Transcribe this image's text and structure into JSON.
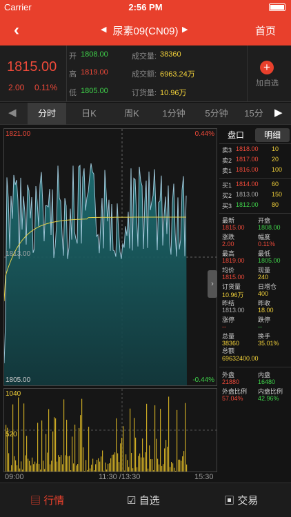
{
  "status": {
    "carrier": "Carrier",
    "time": "2:56 PM"
  },
  "nav": {
    "title": "尿素09(CN09)",
    "home": "首页"
  },
  "quote": {
    "price": "1815.00",
    "change": "2.00",
    "pct": "0.11%",
    "open_label": "开",
    "open": "1808.00",
    "high_label": "高",
    "high": "1819.00",
    "low_label": "低",
    "low": "1805.00",
    "vol_label": "成交量:",
    "vol": "38360",
    "amt_label": "成交额:",
    "amt": "6963.24万",
    "oi_label": "订货量:",
    "oi": "10.96万",
    "add_label": "加自选"
  },
  "tabs": [
    "分时",
    "日K",
    "周K",
    "1分钟",
    "5分钟",
    "15分"
  ],
  "chart": {
    "top_price": "1821.00",
    "bottom_price": "1805.00",
    "mid_price": "1813.00",
    "top_pct": "0.44%",
    "bottom_pct": "-0.44%",
    "vol_top": "1040",
    "vol_mid": "520",
    "x_start": "09:00",
    "x_mid": "11:30 /13:30",
    "x_end": "15:30"
  },
  "side": {
    "tab1": "盘口",
    "tab2": "明细",
    "asks": [
      {
        "label": "卖3",
        "price": "1818.00",
        "qty": "10"
      },
      {
        "label": "卖2",
        "price": "1817.00",
        "qty": "20"
      },
      {
        "label": "卖1",
        "price": "1816.00",
        "qty": "100"
      }
    ],
    "bids": [
      {
        "label": "买1",
        "price": "1814.00",
        "qty": "60"
      },
      {
        "label": "买2",
        "price": "1813.00",
        "qty": "150"
      },
      {
        "label": "买3",
        "price": "1812.00",
        "qty": "80"
      }
    ],
    "stats": [
      {
        "l1": "最新",
        "v1": "1815.00",
        "c1": "red",
        "l2": "开盘",
        "v2": "1808.00",
        "c2": "green"
      },
      {
        "l1": "涨跌",
        "v1": "2.00",
        "c1": "red",
        "l2": "幅度",
        "v2": "0.11%",
        "c2": "red"
      },
      {
        "l1": "最高",
        "v1": "1819.00",
        "c1": "red",
        "l2": "最低",
        "v2": "1805.00",
        "c2": "green"
      },
      {
        "l1": "均价",
        "v1": "1815.00",
        "c1": "red",
        "l2": "现量",
        "v2": "240",
        "c2": "yellow"
      },
      {
        "l1": "订货量",
        "v1": "10.96万",
        "c1": "yellow",
        "l2": "日增仓",
        "v2": "400",
        "c2": "yellow"
      },
      {
        "l1": "昨结",
        "v1": "1813.00",
        "c1": "grey",
        "l2": "昨收",
        "v2": "18.00",
        "c2": "yellow"
      },
      {
        "l1": "涨停",
        "v1": "--",
        "c1": "red",
        "l2": "跌停",
        "v2": "--",
        "c2": "green"
      },
      {
        "l1": "总量",
        "v1": "38360",
        "c1": "yellow",
        "l2": "换手",
        "v2": "35.01%",
        "c2": "yellow"
      }
    ],
    "total_label": "总额",
    "total": "69632400.00",
    "out_label": "外盘",
    "out": "21880",
    "in_label": "内盘",
    "in": "16480",
    "outr_label": "外盘比例",
    "outr": "57.04%",
    "inr_label": "内盘比例",
    "inr": "42.96%"
  },
  "bottom": {
    "quotes": "行情",
    "watch": "自选",
    "trade": "交易"
  }
}
